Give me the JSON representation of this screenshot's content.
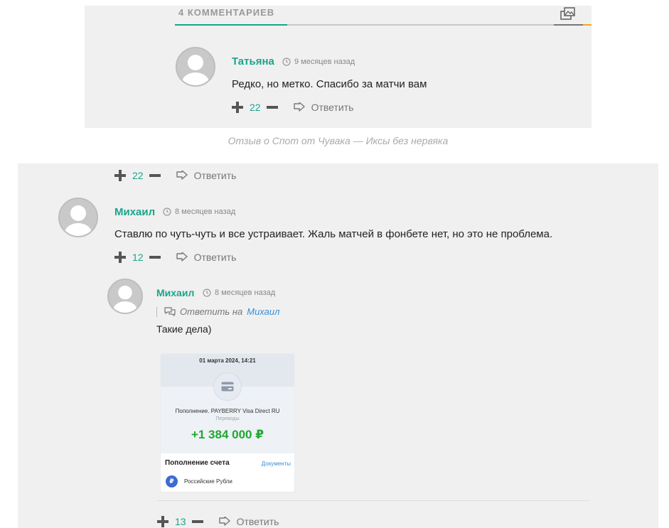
{
  "comments_header": {
    "title": "4 КОММЕНТАРИЕВ",
    "icon": "gallery-icon"
  },
  "top_comment": {
    "author": "Татьяна",
    "time": "9 месяцев назад",
    "text": "Редко, но метко. Спасибо за матчи вам",
    "votes": "22",
    "reply_label": "Ответить"
  },
  "caption": "Отзыв о Спот от Чувака — Иксы без нервяка",
  "bottom": {
    "prev_votes": "22",
    "prev_reply_label": "Ответить",
    "comment": {
      "author": "Михаил",
      "time": "8 месяцев назад",
      "text": "Ставлю по чуть-чуть и все устраивает. Жаль матчей в фонбете нет, но это не проблема.",
      "votes": "12",
      "reply_label": "Ответить"
    },
    "reply": {
      "author": "Михаил",
      "time": "8 месяцев назад",
      "reply_to_label": "Ответить на",
      "reply_to_name": "Михаил",
      "text": "Такие дела)",
      "votes": "13",
      "reply_label": "Ответить"
    },
    "receipt": {
      "date": "01 марта 2024, 14:21",
      "description": "Пополнение. PAYBERRY Visa Direct RU",
      "category": "Переводы",
      "amount": "+1 384 000 ₽",
      "section_title": "Пополнение счета",
      "documents_link": "Документы",
      "currency_symbol": "₽",
      "currency": "Российские Рубли"
    }
  },
  "colors": {
    "accent": "#1aa58a",
    "panel_bg": "#f0f0f0",
    "amount_green": "#1fa832",
    "link_blue": "#3a8fd6",
    "tab_orange": "#f5a623"
  }
}
